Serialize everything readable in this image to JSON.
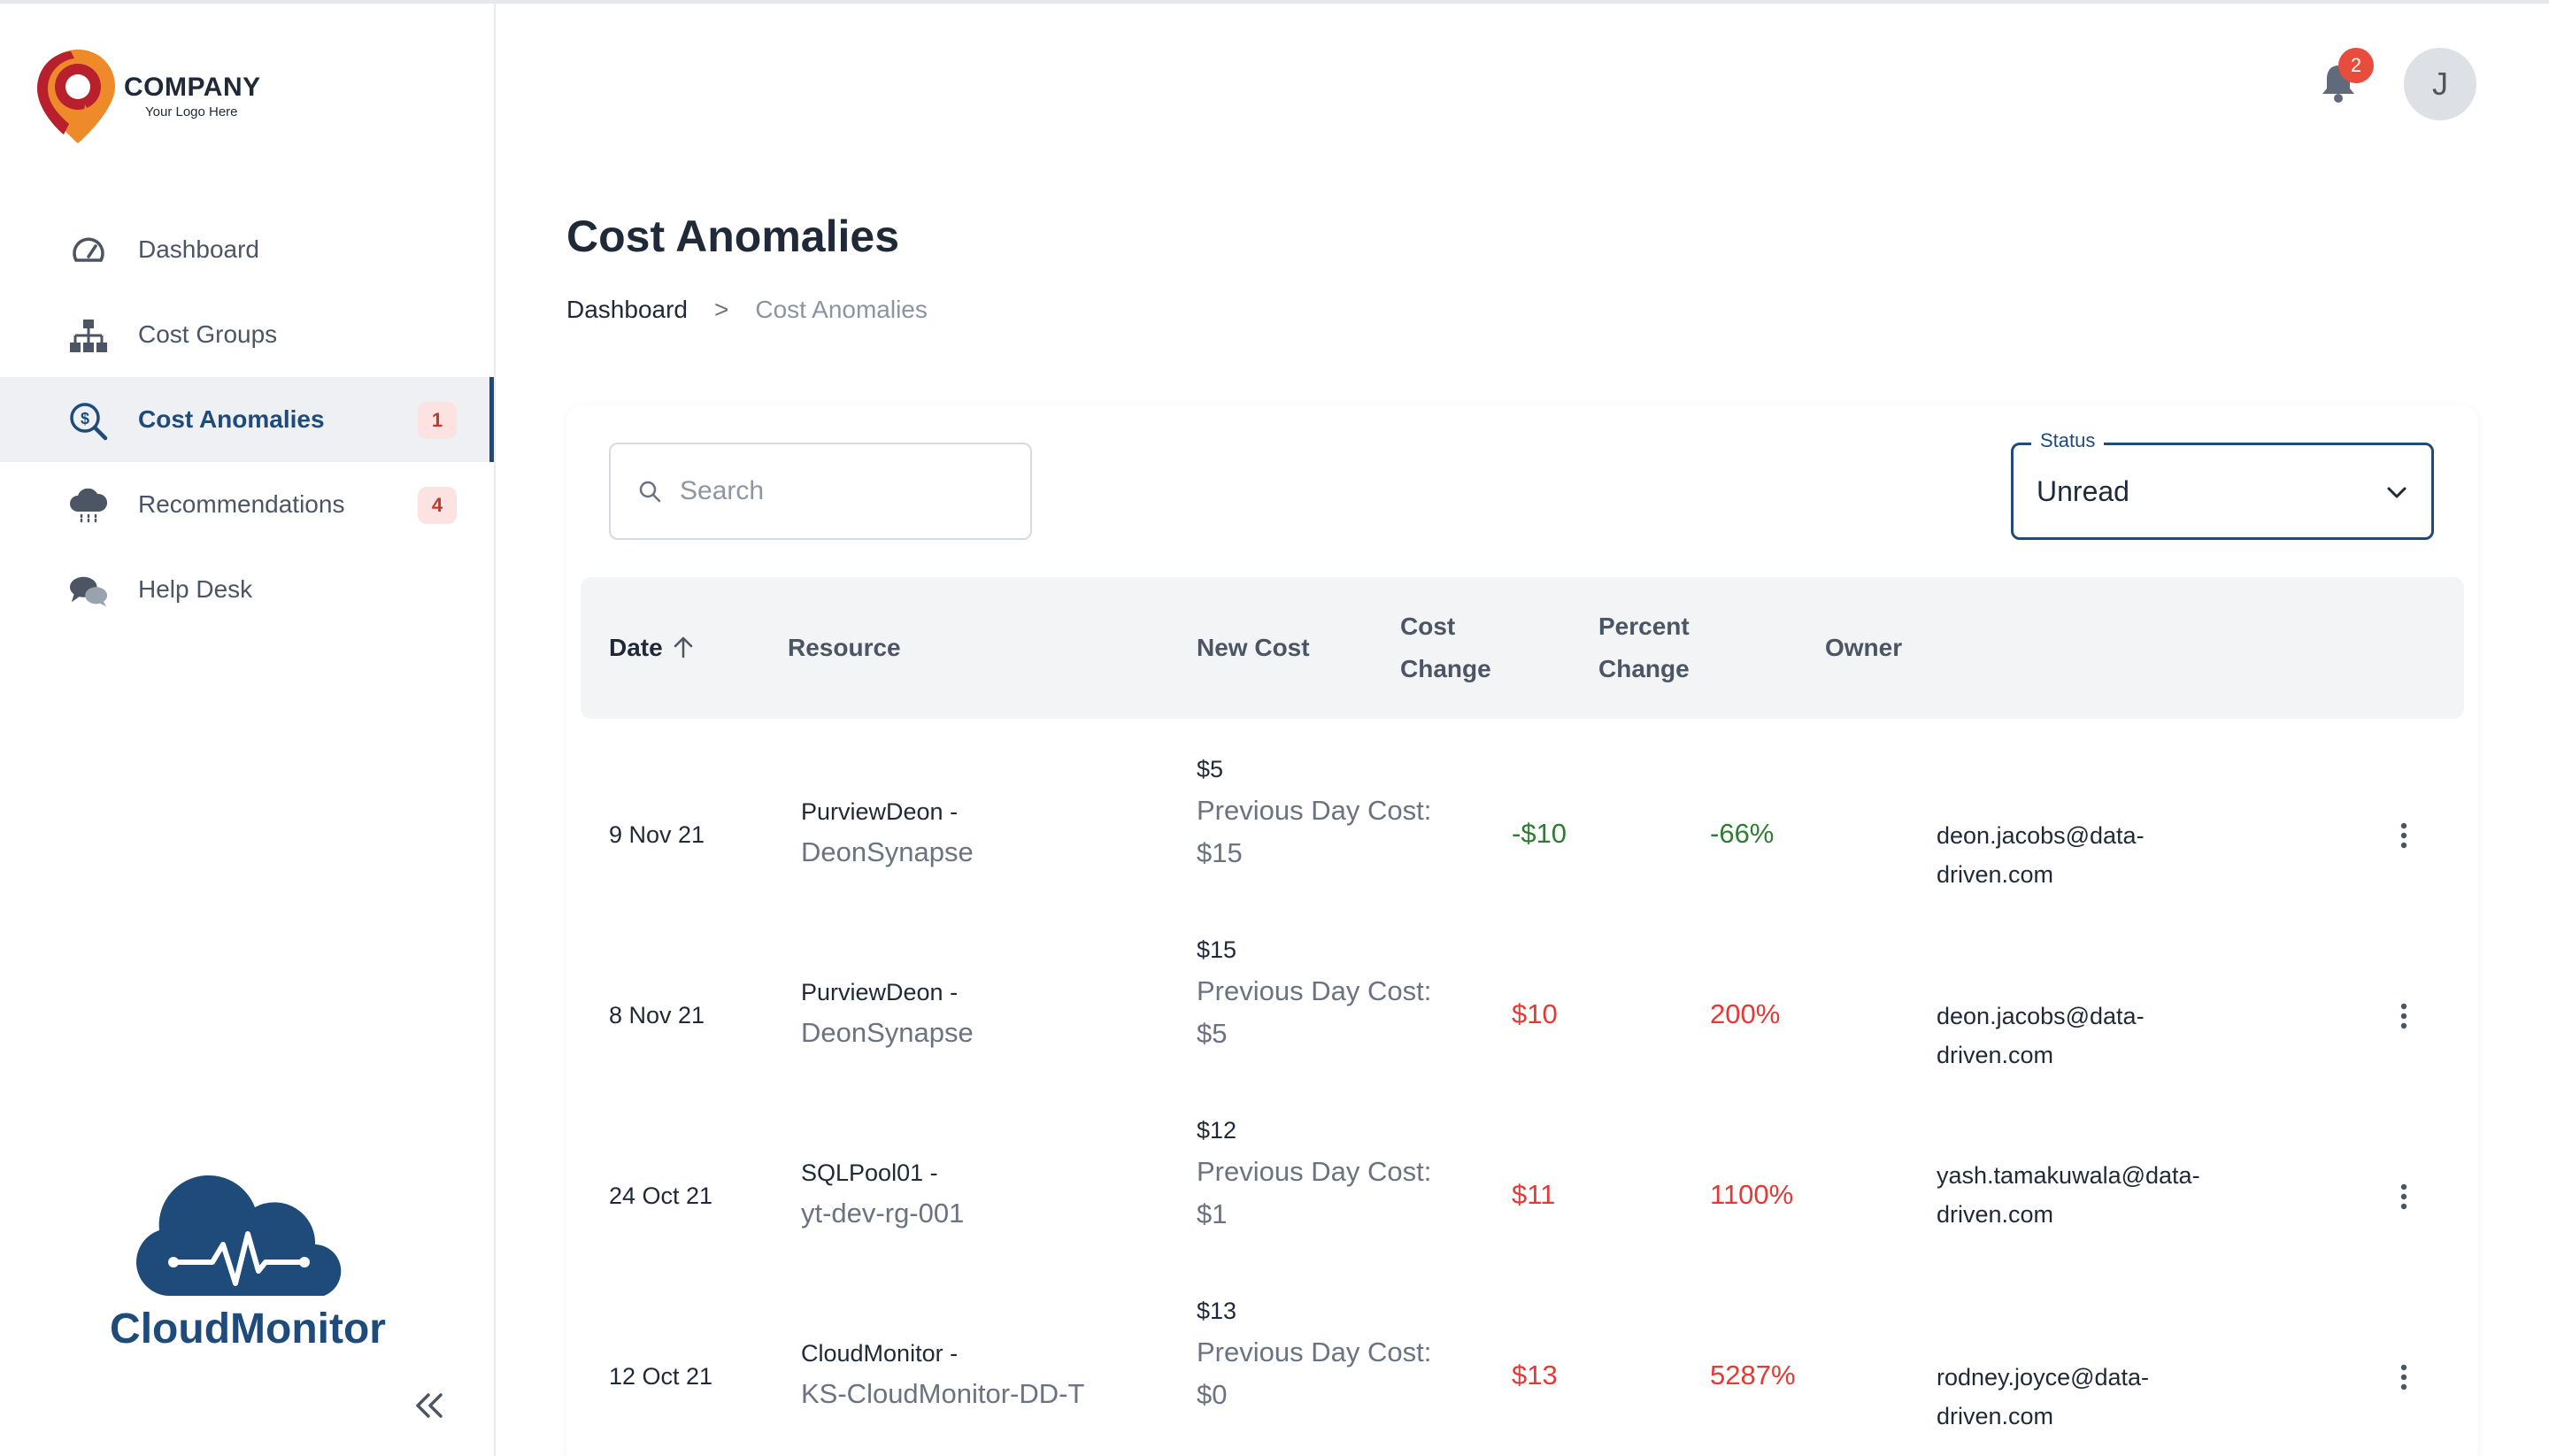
{
  "logo": {
    "company": "COMPANY",
    "tagline": "Your Logo Here"
  },
  "sidebar": {
    "items": [
      {
        "label": "Dashboard",
        "icon": "speedometer-icon",
        "badge": ""
      },
      {
        "label": "Cost Groups",
        "icon": "hierarchy-icon",
        "badge": ""
      },
      {
        "label": "Cost Anomalies",
        "icon": "dollar-search-icon",
        "badge": "1",
        "active": true
      },
      {
        "label": "Recommendations",
        "icon": "cloud-rain-icon",
        "badge": "4"
      },
      {
        "label": "Help Desk",
        "icon": "chat-bubbles-icon",
        "badge": ""
      }
    ],
    "brand": "CloudMonitor"
  },
  "header": {
    "notification_count": "2",
    "avatar_initial": "J"
  },
  "page": {
    "title": "Cost Anomalies"
  },
  "breadcrumb": {
    "home": "Dashboard",
    "separator": ">",
    "current": "Cost Anomalies"
  },
  "search": {
    "placeholder": "Search",
    "value": ""
  },
  "status_filter": {
    "label": "Status",
    "value": "Unread"
  },
  "table": {
    "columns": {
      "date": "Date",
      "resource": "Resource",
      "new_cost": "New Cost",
      "cost_change_1": "Cost",
      "cost_change_2": "Change",
      "percent_change_1": "Percent",
      "percent_change_2": "Change",
      "owner": "Owner"
    },
    "rows": [
      {
        "date": "9 Nov 21",
        "resource_name": "PurviewDeon -",
        "resource_group": "DeonSynapse",
        "new_cost": "$5",
        "prev_label": "Previous Day Cost:",
        "prev_cost": "$15",
        "cost_change": "-$10",
        "percent_change": "-66%",
        "direction": "down",
        "owner_1": "deon.jacobs@data-driven.com",
        "owner_2": ""
      },
      {
        "date": "8 Nov 21",
        "resource_name": "PurviewDeon -",
        "resource_group": "DeonSynapse",
        "new_cost": "$15",
        "prev_label": "Previous Day Cost:",
        "prev_cost": "$5",
        "cost_change": "$10",
        "percent_change": "200%",
        "direction": "up",
        "owner_1": "deon.jacobs@data-driven.com",
        "owner_2": ""
      },
      {
        "date": "24 Oct 21",
        "resource_name": "SQLPool01 -",
        "resource_group": "yt-dev-rg-001",
        "new_cost": "$12",
        "prev_label": "Previous Day Cost:",
        "prev_cost": "$1",
        "cost_change": "$11",
        "percent_change": "1100%",
        "direction": "up",
        "owner_1": "yash.tamakuwala@data-",
        "owner_2": "driven.com"
      },
      {
        "date": "12 Oct 21",
        "resource_name": "CloudMonitor -",
        "resource_group": "KS-CloudMonitor-DD-T",
        "new_cost": "$13",
        "prev_label": "Previous Day Cost:",
        "prev_cost": "$0",
        "cost_change": "$13",
        "percent_change": "5287%",
        "direction": "up",
        "owner_1": "rodney.joyce@data-driven.com",
        "owner_2": ""
      }
    ]
  },
  "colors": {
    "primary": "#1e4b7a",
    "positive": "#2e7d32",
    "negative": "#e53935",
    "badge_bg": "#fde2e2"
  }
}
